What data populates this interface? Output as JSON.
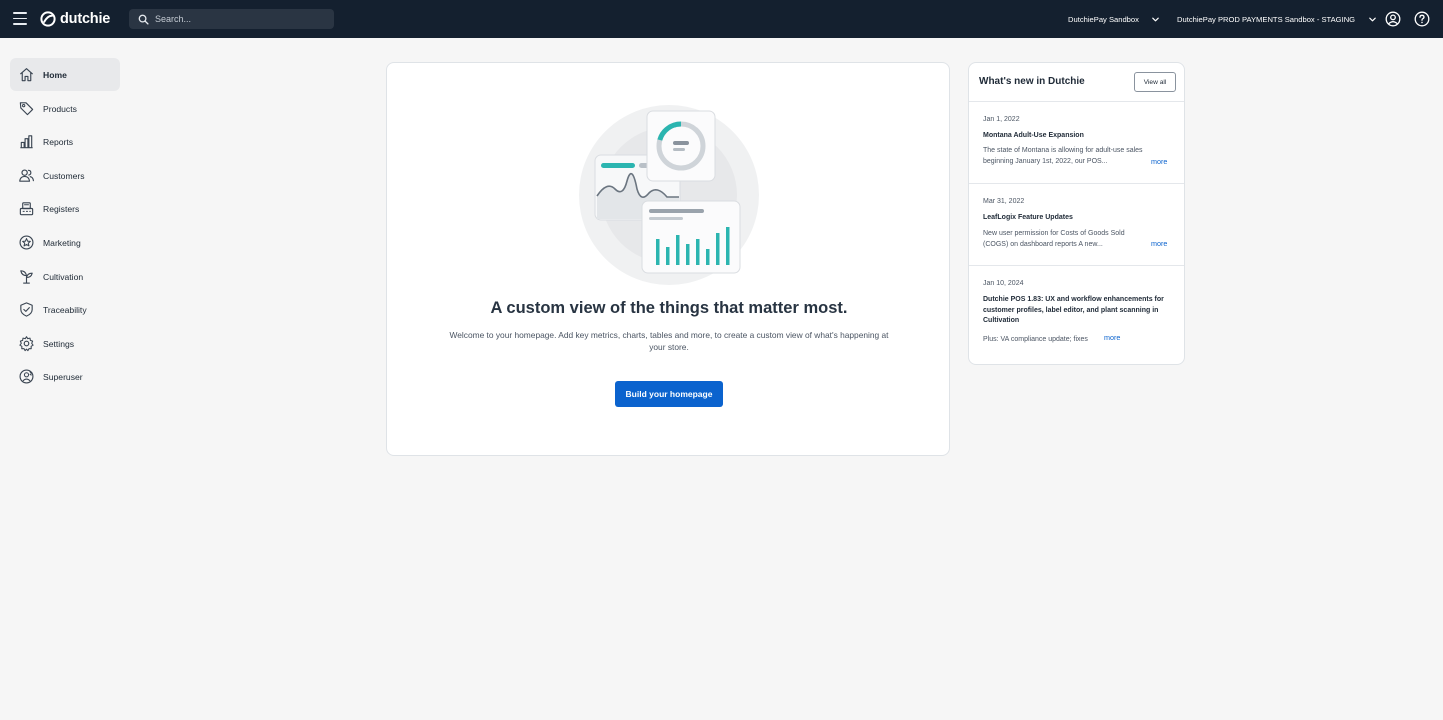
{
  "app": {
    "brand": "dutchie",
    "colors": {
      "topbar": "#14202f",
      "primary": "#0b63ce",
      "accent": "#2bb5b0"
    }
  },
  "search": {
    "placeholder": "Search..."
  },
  "header": {
    "selectors": [
      {
        "label": "DutchiePay Sandbox",
        "icon": "chevron-down-icon"
      },
      {
        "label": "DutchiePay PROD PAYMENTS Sandbox - STAGING",
        "icon": "chevron-down-icon"
      }
    ],
    "icons": [
      "account-icon",
      "help-icon"
    ]
  },
  "sidebar": {
    "items": [
      {
        "label": "Home",
        "icon": "home-icon",
        "active": true
      },
      {
        "label": "Products",
        "icon": "tag-icon"
      },
      {
        "label": "Reports",
        "icon": "bar-chart-icon"
      },
      {
        "label": "Customers",
        "icon": "users-icon"
      },
      {
        "label": "Registers",
        "icon": "register-icon"
      },
      {
        "label": "Marketing",
        "icon": "star-badge-icon"
      },
      {
        "label": "Cultivation",
        "icon": "plant-icon"
      },
      {
        "label": "Traceability",
        "icon": "shield-check-icon"
      },
      {
        "label": "Settings",
        "icon": "gear-icon"
      },
      {
        "label": "Superuser",
        "icon": "superuser-icon"
      }
    ]
  },
  "main": {
    "headline": "A custom view of the things that matter most.",
    "subtext": "Welcome to your homepage. Add key metrics, charts, tables and more, to create a custom view of what's happening at your store.",
    "cta_label": "Build your homepage"
  },
  "news": {
    "title": "What's new in Dutchie",
    "view_all_label": "View all",
    "items": [
      {
        "date": "Jan 1, 2022",
        "heading": "Montana Adult-Use Expansion",
        "body": "The state of Montana is allowing for adult-use sales beginning January 1st, 2022, our POS...",
        "more": "more"
      },
      {
        "date": "Mar 31, 2022",
        "heading": "LeafLogix Feature Updates",
        "body": "New user permission for Costs of Goods Sold (COGS) on dashboard reports A new...",
        "more": "more"
      },
      {
        "date": "Jan 10, 2024",
        "heading": "Dutchie POS 1.83: UX and workflow enhancements for customer profiles, label editor, and plant scanning in Cultivation",
        "body": "Plus: VA compliance update; fixes",
        "more": "more"
      }
    ]
  }
}
